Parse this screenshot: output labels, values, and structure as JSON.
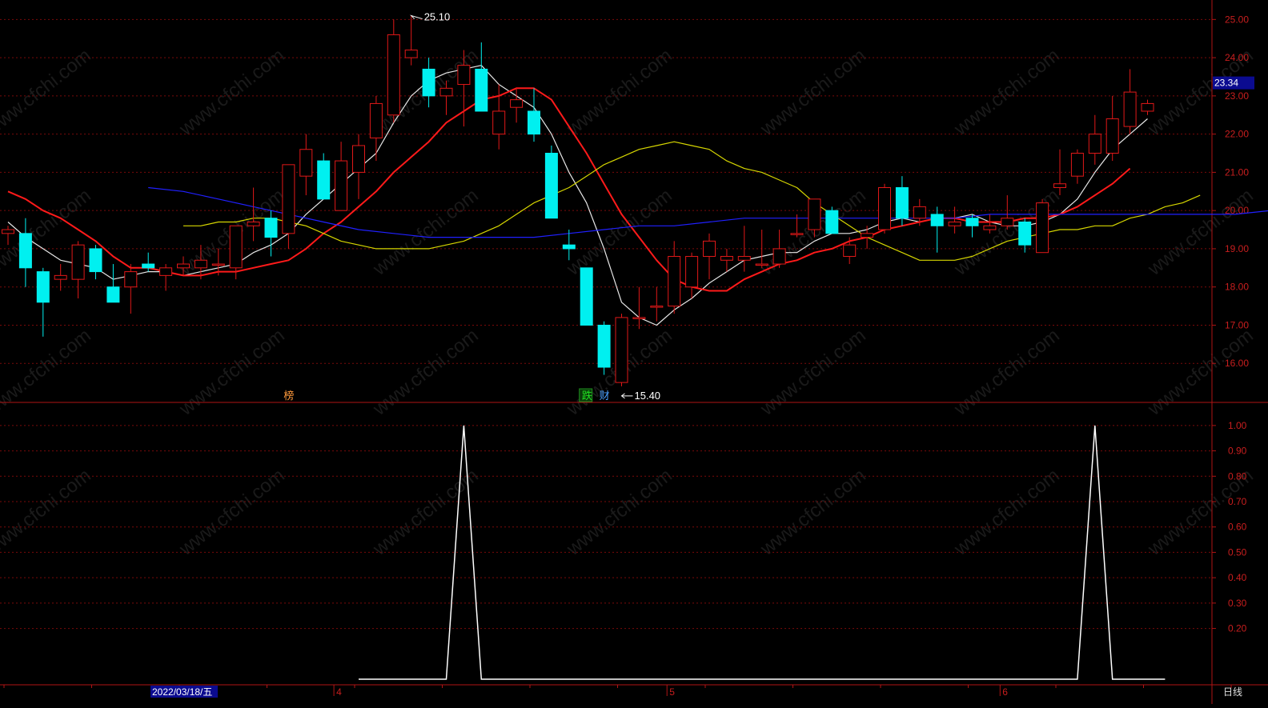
{
  "colors": {
    "background": "#000000",
    "frame": "#b01414",
    "grid": "#7a0a0a",
    "up": "#e01818",
    "down": "#00f0f0",
    "axis_text": "#c81e1e",
    "ma5": "#e8e8e8",
    "ma10": "#ff1a1a",
    "ma20": "#d6d600",
    "ma60": "#2020ff",
    "indicator": "#ffffff",
    "current_price_bg": "#0b0b90",
    "date_bg": "#0b0b90"
  },
  "labels": {
    "high": "25.10",
    "low": "15.40",
    "current_price": "23.34",
    "date_cursor": "2022/03/18/五",
    "period": "日线",
    "watermark": "www.cfchi.com",
    "markers": [
      {
        "text": "榜",
        "color": "#ff9a3c",
        "candle": 16
      },
      {
        "text": "跌",
        "color": "#20e020",
        "candle": 33,
        "boxed": true
      },
      {
        "text": "财",
        "color": "#4aa0ff",
        "candle": 34
      }
    ]
  },
  "chart_data": [
    {
      "type": "candlestick",
      "ylim": [
        15.0,
        25.3
      ],
      "y_ticks": [
        "16.00",
        "17.00",
        "18.00",
        "19.00",
        "20.00",
        "21.00",
        "22.00",
        "23.00",
        "24.00",
        "25.00"
      ],
      "x_ticks": [
        {
          "label": "4",
          "candle": 19
        },
        {
          "label": "5",
          "candle": 38
        },
        {
          "label": "6",
          "candle": 57
        }
      ],
      "candles": [
        {
          "o": 19.4,
          "h": 19.6,
          "l": 19.1,
          "c": 19.5
        },
        {
          "o": 19.4,
          "h": 19.8,
          "l": 18.0,
          "c": 18.5
        },
        {
          "o": 18.4,
          "h": 18.5,
          "l": 16.7,
          "c": 17.6
        },
        {
          "o": 18.2,
          "h": 18.6,
          "l": 17.9,
          "c": 18.3
        },
        {
          "o": 18.2,
          "h": 19.2,
          "l": 17.7,
          "c": 19.1
        },
        {
          "o": 19.0,
          "h": 19.1,
          "l": 18.2,
          "c": 18.4
        },
        {
          "o": 18.0,
          "h": 18.6,
          "l": 17.6,
          "c": 17.6
        },
        {
          "o": 18.0,
          "h": 18.6,
          "l": 17.3,
          "c": 18.4
        },
        {
          "o": 18.6,
          "h": 18.9,
          "l": 18.4,
          "c": 18.5
        },
        {
          "o": 18.3,
          "h": 18.6,
          "l": 17.9,
          "c": 18.5
        },
        {
          "o": 18.5,
          "h": 18.8,
          "l": 18.3,
          "c": 18.6
        },
        {
          "o": 18.5,
          "h": 19.1,
          "l": 18.2,
          "c": 18.7
        },
        {
          "o": 18.6,
          "h": 19.0,
          "l": 18.3,
          "c": 18.6
        },
        {
          "o": 18.5,
          "h": 19.6,
          "l": 18.2,
          "c": 19.6
        },
        {
          "o": 19.6,
          "h": 20.6,
          "l": 19.2,
          "c": 19.7
        },
        {
          "o": 19.8,
          "h": 20.0,
          "l": 18.8,
          "c": 19.3
        },
        {
          "o": 19.4,
          "h": 21.2,
          "l": 19.0,
          "c": 21.2
        },
        {
          "o": 20.9,
          "h": 22.0,
          "l": 20.4,
          "c": 21.6
        },
        {
          "o": 21.3,
          "h": 21.5,
          "l": 20.3,
          "c": 20.3
        },
        {
          "o": 20.0,
          "h": 21.8,
          "l": 20.0,
          "c": 21.3
        },
        {
          "o": 21.0,
          "h": 22.0,
          "l": 20.3,
          "c": 21.7
        },
        {
          "o": 21.9,
          "h": 23.0,
          "l": 21.3,
          "c": 22.8
        },
        {
          "o": 22.5,
          "h": 25.0,
          "l": 22.3,
          "c": 24.6
        },
        {
          "o": 24.0,
          "h": 25.1,
          "l": 23.8,
          "c": 24.2
        },
        {
          "o": 23.7,
          "h": 24.0,
          "l": 22.7,
          "c": 23.0
        },
        {
          "o": 23.0,
          "h": 23.4,
          "l": 22.5,
          "c": 23.2
        },
        {
          "o": 23.3,
          "h": 24.2,
          "l": 22.2,
          "c": 23.8
        },
        {
          "o": 23.7,
          "h": 24.4,
          "l": 22.6,
          "c": 22.6
        },
        {
          "o": 22.0,
          "h": 23.3,
          "l": 21.6,
          "c": 22.6
        },
        {
          "o": 22.7,
          "h": 23.2,
          "l": 22.3,
          "c": 22.9
        },
        {
          "o": 22.6,
          "h": 23.2,
          "l": 21.8,
          "c": 22.0
        },
        {
          "o": 21.5,
          "h": 21.7,
          "l": 19.8,
          "c": 19.8
        },
        {
          "o": 19.1,
          "h": 19.5,
          "l": 18.7,
          "c": 19.0
        },
        {
          "o": 18.5,
          "h": 18.5,
          "l": 17.0,
          "c": 17.0
        },
        {
          "o": 17.0,
          "h": 17.1,
          "l": 15.7,
          "c": 15.9
        },
        {
          "o": 15.5,
          "h": 17.3,
          "l": 15.4,
          "c": 17.2
        },
        {
          "o": 17.2,
          "h": 18.0,
          "l": 16.9,
          "c": 17.2
        },
        {
          "o": 17.5,
          "h": 18.0,
          "l": 17.1,
          "c": 17.5
        },
        {
          "o": 17.5,
          "h": 19.2,
          "l": 17.3,
          "c": 18.8
        },
        {
          "o": 18.0,
          "h": 18.9,
          "l": 17.7,
          "c": 18.8
        },
        {
          "o": 18.8,
          "h": 19.4,
          "l": 18.2,
          "c": 19.2
        },
        {
          "o": 18.7,
          "h": 19.0,
          "l": 18.4,
          "c": 18.8
        },
        {
          "o": 18.7,
          "h": 19.6,
          "l": 18.4,
          "c": 18.8
        },
        {
          "o": 18.6,
          "h": 19.5,
          "l": 18.5,
          "c": 18.6
        },
        {
          "o": 18.6,
          "h": 19.5,
          "l": 18.5,
          "c": 19.0
        },
        {
          "o": 19.4,
          "h": 19.9,
          "l": 19.3,
          "c": 19.4
        },
        {
          "o": 19.5,
          "h": 20.3,
          "l": 19.3,
          "c": 20.3
        },
        {
          "o": 20.0,
          "h": 20.1,
          "l": 19.4,
          "c": 19.4
        },
        {
          "o": 18.8,
          "h": 19.3,
          "l": 18.6,
          "c": 19.1
        },
        {
          "o": 19.3,
          "h": 19.6,
          "l": 19.0,
          "c": 19.4
        },
        {
          "o": 19.5,
          "h": 20.7,
          "l": 19.4,
          "c": 20.6
        },
        {
          "o": 20.6,
          "h": 20.9,
          "l": 19.6,
          "c": 19.8
        },
        {
          "o": 19.8,
          "h": 20.3,
          "l": 19.6,
          "c": 20.1
        },
        {
          "o": 19.9,
          "h": 20.1,
          "l": 18.9,
          "c": 19.6
        },
        {
          "o": 19.6,
          "h": 20.1,
          "l": 19.4,
          "c": 19.7
        },
        {
          "o": 19.8,
          "h": 19.9,
          "l": 19.3,
          "c": 19.6
        },
        {
          "o": 19.5,
          "h": 19.9,
          "l": 19.4,
          "c": 19.6
        },
        {
          "o": 19.6,
          "h": 20.4,
          "l": 19.5,
          "c": 19.8
        },
        {
          "o": 19.7,
          "h": 19.8,
          "l": 18.9,
          "c": 19.1
        },
        {
          "o": 18.9,
          "h": 20.3,
          "l": 18.9,
          "c": 20.2
        },
        {
          "o": 20.6,
          "h": 21.6,
          "l": 20.4,
          "c": 20.7
        },
        {
          "o": 20.9,
          "h": 21.6,
          "l": 20.7,
          "c": 21.5
        },
        {
          "o": 21.5,
          "h": 22.5,
          "l": 21.2,
          "c": 22.0
        },
        {
          "o": 21.5,
          "h": 23.0,
          "l": 21.3,
          "c": 22.4
        },
        {
          "o": 22.2,
          "h": 23.7,
          "l": 22.0,
          "c": 23.1
        },
        {
          "o": 22.6,
          "h": 22.9,
          "l": 22.5,
          "c": 22.8
        }
      ],
      "series": [
        {
          "color": "#e8e8e8",
          "values": [
            19.7,
            19.3,
            19.0,
            18.7,
            18.6,
            18.5,
            18.2,
            18.3,
            18.4,
            18.4,
            18.3,
            18.4,
            18.5,
            18.6,
            18.9,
            19.1,
            19.4,
            19.9,
            20.3,
            20.7,
            21.1,
            21.5,
            22.3,
            23.0,
            23.4,
            23.6,
            23.7,
            23.8,
            23.3,
            23.0,
            22.7,
            22.0,
            21.0,
            20.2,
            19.0,
            17.6,
            17.2,
            17.0,
            17.4,
            17.7,
            18.1,
            18.4,
            18.7,
            18.8,
            18.9,
            18.9,
            19.2,
            19.4,
            19.4,
            19.5,
            19.7,
            19.8,
            19.7,
            19.8,
            19.8,
            19.9,
            19.7,
            19.6,
            19.6,
            19.7,
            19.9,
            20.3,
            21.0,
            21.6,
            22.0,
            22.4
          ]
        },
        {
          "color": "#ff1a1a",
          "values": [
            20.5,
            20.3,
            20.0,
            19.8,
            19.5,
            19.2,
            18.8,
            18.5,
            18.5,
            18.4,
            18.3,
            18.3,
            18.4,
            18.4,
            18.5,
            18.6,
            18.7,
            19.0,
            19.4,
            19.7,
            20.1,
            20.5,
            21.0,
            21.4,
            21.8,
            22.3,
            22.6,
            22.9,
            23.0,
            23.2,
            23.2,
            22.9,
            22.2,
            21.5,
            20.7,
            19.9,
            19.3,
            18.7,
            18.2,
            18.0,
            17.9,
            17.9,
            18.2,
            18.4,
            18.6,
            18.7,
            18.9,
            19.0,
            19.2,
            19.3,
            19.5,
            19.6,
            19.7,
            19.8,
            19.8,
            19.7,
            19.7,
            19.7,
            19.8,
            19.8,
            19.9,
            20.1,
            20.4,
            20.7,
            21.1
          ]
        },
        {
          "color": "#d6d600",
          "values": [
            19.6,
            19.6,
            19.7,
            19.7,
            19.8,
            19.8,
            19.7,
            19.6,
            19.4,
            19.2,
            19.1,
            19.0,
            19.0,
            19.0,
            19.0,
            19.1,
            19.2,
            19.4,
            19.6,
            19.9,
            20.2,
            20.4,
            20.6,
            20.9,
            21.2,
            21.4,
            21.6,
            21.7,
            21.8,
            21.7,
            21.6,
            21.3,
            21.1,
            21.0,
            20.8,
            20.6,
            20.2,
            19.9,
            19.6,
            19.3,
            19.1,
            18.9,
            18.7,
            18.7,
            18.7,
            18.8,
            19.0,
            19.2,
            19.3,
            19.4,
            19.5,
            19.5,
            19.6,
            19.6,
            19.8,
            19.9,
            20.1,
            20.2,
            20.4
          ]
        },
        {
          "color": "#2020ff",
          "values": [
            20.6,
            20.5,
            20.3,
            20.1,
            19.9,
            19.7,
            19.5,
            19.4,
            19.3,
            19.3,
            19.3,
            19.3,
            19.4,
            19.5,
            19.6,
            19.6,
            19.7,
            19.8,
            19.8,
            19.8,
            19.8,
            19.8,
            19.8,
            19.8,
            19.9,
            19.9,
            19.9,
            19.9,
            19.9,
            19.9,
            19.9,
            19.9,
            20.0,
            20.0,
            20.2
          ]
        }
      ]
    },
    {
      "type": "line",
      "ylim": [
        0.0,
        1.05
      ],
      "y_ticks": [
        "0.20",
        "0.30",
        "0.40",
        "0.50",
        "0.60",
        "0.70",
        "0.80",
        "0.90",
        "1.00"
      ],
      "series": [
        {
          "color": "#ffffff",
          "values": [
            0,
            0,
            0,
            0,
            0,
            0,
            1,
            0,
            0,
            0,
            0,
            0,
            0,
            0,
            0,
            0,
            0,
            0,
            0,
            0,
            0,
            0,
            0,
            0,
            0,
            0,
            0,
            0,
            0,
            0,
            0,
            0,
            0,
            0,
            0,
            0,
            0,
            0,
            0,
            0,
            0,
            0,
            1,
            0,
            0,
            0,
            0
          ],
          "start_candle": 20
        }
      ]
    }
  ]
}
